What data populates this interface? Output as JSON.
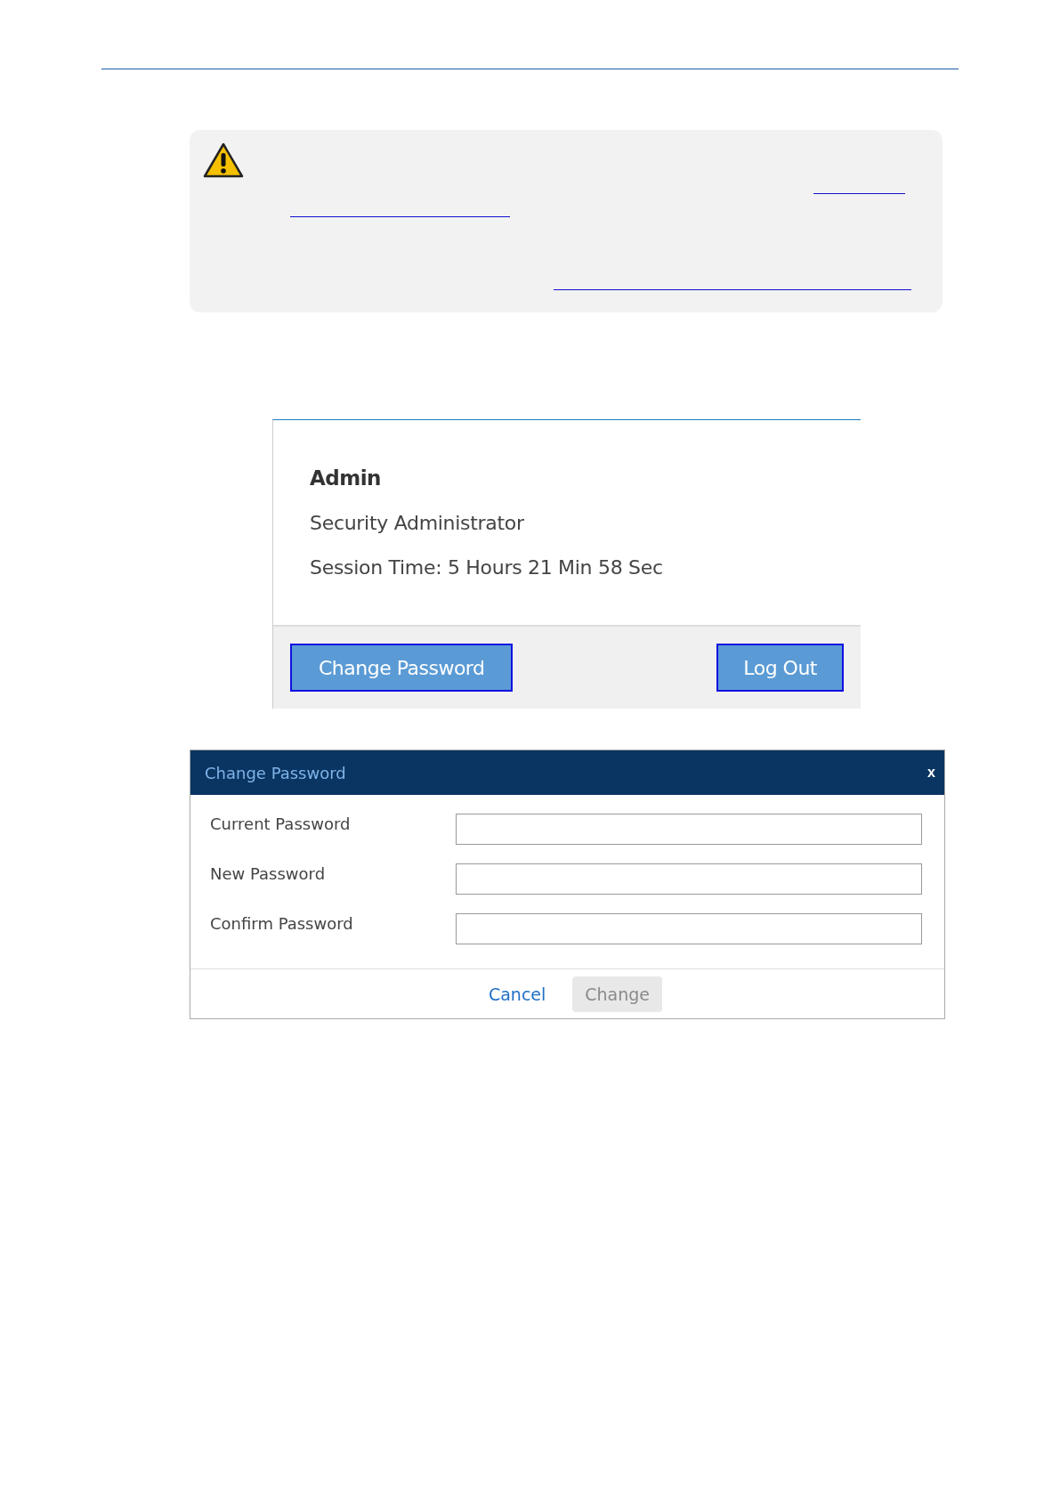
{
  "note": {
    "kind": "warning"
  },
  "account_panel": {
    "name": "Admin",
    "role": "Security Administrator",
    "session_time": "Session Time: 5 Hours 21 Min 58 Sec",
    "buttons": [
      {
        "label": "Change Password",
        "kind": "left"
      },
      {
        "label": "Log Out",
        "kind": "right"
      }
    ]
  },
  "dialog": {
    "title": "Change Password",
    "close": "x",
    "fields": [
      {
        "label": "Current Password"
      },
      {
        "label": "New Password"
      },
      {
        "label": "Confirm Password"
      }
    ],
    "buttons": [
      {
        "label": "Cancel",
        "kind": "link",
        "disabled": false
      },
      {
        "label": "Change",
        "kind": "button",
        "disabled": true
      }
    ]
  }
}
